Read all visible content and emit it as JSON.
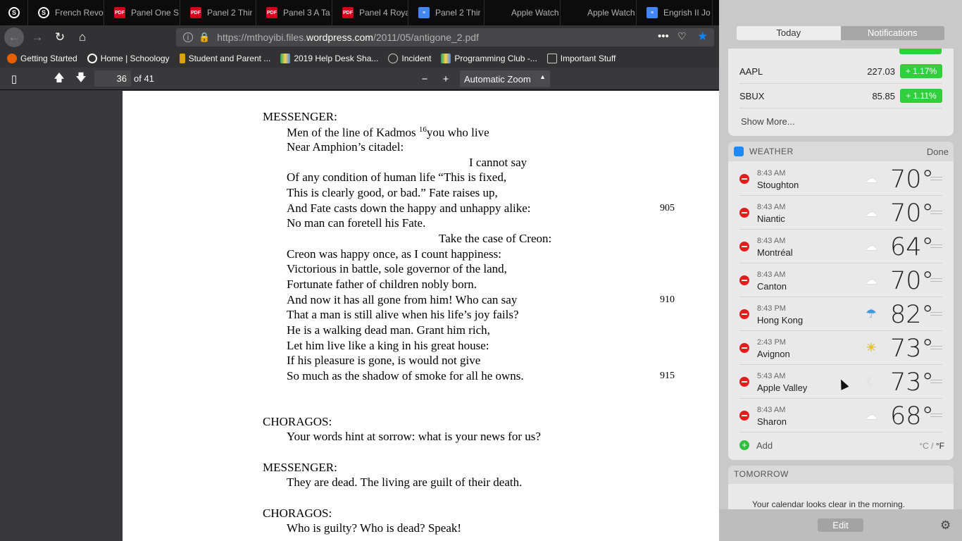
{
  "tabs": [
    {
      "icon": "schoology",
      "label": ""
    },
    {
      "icon": "schoology",
      "label": "French Revo"
    },
    {
      "icon": "pdf",
      "label": "Panel One S"
    },
    {
      "icon": "pdf",
      "label": "Panel 2 Thir"
    },
    {
      "icon": "pdf",
      "label": "Panel 3 A Ta"
    },
    {
      "icon": "pdf",
      "label": "Panel 4 Roya"
    },
    {
      "icon": "doc",
      "label": "Panel 2 Thir"
    },
    {
      "icon": "apple",
      "label": "Apple Watch"
    },
    {
      "icon": "apple",
      "label": "Apple Watch"
    },
    {
      "icon": "doc",
      "label": "Engrish II Jo"
    }
  ],
  "url": {
    "prefix": "https://mthoyibi.files.",
    "host": "wordpress.com",
    "path": "/2011/05/antigone_2.pdf"
  },
  "bookmarks": [
    {
      "icon": "firefox",
      "label": "Getting Started"
    },
    {
      "icon": "schoology",
      "label": "Home | Schoology"
    },
    {
      "icon": "pearson",
      "label": "Student and Parent ..."
    },
    {
      "icon": "drive",
      "label": "2019 Help Desk Sha..."
    },
    {
      "icon": "globe",
      "label": "Incident"
    },
    {
      "icon": "drive",
      "label": "Programming Club -..."
    },
    {
      "icon": "folder",
      "label": "Important Stuff"
    }
  ],
  "pdf": {
    "page": "36",
    "of": "of 41",
    "zoom": "Automatic Zoom"
  },
  "poem": {
    "speaker1": "MESSENGER:",
    "l1a": "Men of the line of Kadmos ",
    "l1sup": "16",
    "l1b": "you who live",
    "l2": "Near Amphion’s citadel:",
    "l3": "I cannot say",
    "l4": "Of any condition of human life “This is fixed,",
    "l5": "This is clearly good, or bad.” Fate raises up,",
    "l6": "And Fate casts down the happy and unhappy alike:",
    "n905": "905",
    "l7": "No man can foretell his Fate.",
    "l8": "Take the case of Creon:",
    "l9": "Creon was happy once, as I count happiness:",
    "l10": "Victorious in battle, sole governor of the land,",
    "l11": "Fortunate father of children nobly born.",
    "l12": "And now it has all gone from him! Who can say",
    "n910": "910",
    "l13": "That a man is still alive when his life’s joy fails?",
    "l14": "He is a walking dead man. Grant him rich,",
    "l15": "Let him live like a king in his great house:",
    "l16": "If his pleasure is gone, is would not give",
    "l17": "So much as the shadow of smoke for all he owns.",
    "n915": "915",
    "speaker2": "CHORAGOS:",
    "l18": "Your words hint at sorrow: what is your news for us?",
    "speaker3": "MESSENGER:",
    "l19": "They are dead. The living are guilt of their death.",
    "speaker4": "CHORAGOS:",
    "l20": "Who is guilty? Who is dead? Speak!"
  },
  "panel": {
    "tab_today": "Today",
    "tab_notifications": "Notifications",
    "stocks": [
      {
        "symbol": "AAPL",
        "price": "227.03",
        "change": "+ 1.17%"
      },
      {
        "symbol": "SBUX",
        "price": "85.85",
        "change": "+ 1.11%"
      }
    ],
    "show_more": "Show More...",
    "weather_title": "WEATHER",
    "weather_done": "Done",
    "weather": [
      {
        "time": "8:43 AM",
        "city": "Stoughton",
        "temp": "70°",
        "cond": "cloud-icon"
      },
      {
        "time": "8:43 AM",
        "city": "Niantic",
        "temp": "70°",
        "cond": "cloud-icon"
      },
      {
        "time": "8:43 AM",
        "city": "Montréal",
        "temp": "64°",
        "cond": "cloud-icon"
      },
      {
        "time": "8:43 AM",
        "city": "Canton",
        "temp": "70°",
        "cond": "cloud-icon"
      },
      {
        "time": "8:43 PM",
        "city": "Hong Kong",
        "temp": "82°",
        "cond": "rain-icon"
      },
      {
        "time": "2:43 PM",
        "city": "Avignon",
        "temp": "73°",
        "cond": "sun-icon"
      },
      {
        "time": "5:43 AM",
        "city": "Apple Valley",
        "temp": "73°",
        "cond": "moon-icon"
      },
      {
        "time": "8:43 AM",
        "city": "Sharon",
        "temp": "68°",
        "cond": "cloud-icon"
      }
    ],
    "add": "Add",
    "unit_c": "°C",
    "unit_sep": "/",
    "unit_f": "°F",
    "tomorrow_title": "TOMORROW",
    "tomorrow_text": "Your calendar looks clear in the morning.",
    "edit": "Edit"
  },
  "colors": {
    "accent": "#0a84ff",
    "stock_green": "#2fd03c",
    "remove_red": "#e81c1c",
    "add_green": "#2fbf3c"
  }
}
